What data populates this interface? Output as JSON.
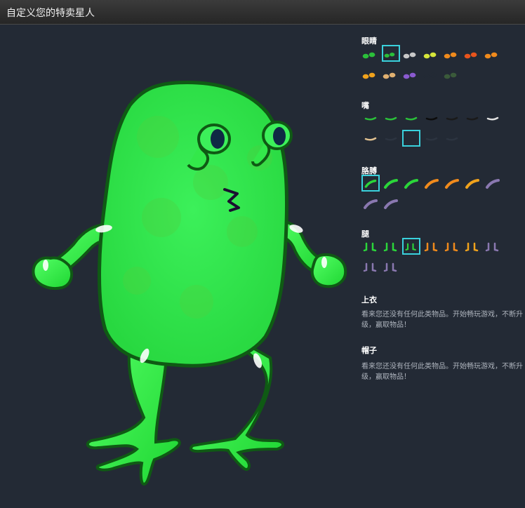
{
  "window": {
    "title": "自定义您的特卖星人"
  },
  "sections": {
    "eyes": {
      "title": "眼睛",
      "selected_index": 1,
      "items": [
        {
          "icon": "eyes-green-small-icon",
          "color": "#2bbf3a"
        },
        {
          "icon": "eyes-green-stalk-icon",
          "color": "#2bbf3a"
        },
        {
          "icon": "eyes-grey-icon",
          "color": "#c8c8c8"
        },
        {
          "icon": "eye-yellow-ring-icon",
          "color": "#d6e63a"
        },
        {
          "icon": "eyes-orange-icon",
          "color": "#f08a1c"
        },
        {
          "icon": "eyes-orange-red-icon",
          "color": "#e8541c"
        },
        {
          "icon": "eyes-orange-wide-icon",
          "color": "#f08a1c"
        },
        {
          "icon": "eyes-orange-yellow-icon",
          "color": "#f0a21c"
        },
        {
          "icon": "eyes-tan-icon",
          "color": "#e0b070"
        },
        {
          "icon": "eye-purple-icon",
          "color": "#8a5ad0"
        },
        {
          "icon": "eyes-none-icon",
          "color": "#232a35"
        },
        {
          "icon": "eyes-dots-icon",
          "color": "#3a5a3a"
        }
      ]
    },
    "mouth": {
      "title": "嘴",
      "selected_index": 9,
      "items": [
        {
          "icon": "mouth-green-icon",
          "color": "#2bbf3a"
        },
        {
          "icon": "mouth-green-2-icon",
          "color": "#2bbf3a"
        },
        {
          "icon": "mouth-green-3-icon",
          "color": "#2bbf3a"
        },
        {
          "icon": "mouth-black-icon",
          "color": "#0c0c0c"
        },
        {
          "icon": "mouth-dark-icon",
          "color": "#1a1a1a"
        },
        {
          "icon": "mouth-dark-2-icon",
          "color": "#1a1a1a"
        },
        {
          "icon": "mouth-teeth-icon",
          "color": "#e0e0e0"
        },
        {
          "icon": "mouth-tan-icon",
          "color": "#e0c090"
        },
        {
          "icon": "mouth-faint-icon",
          "color": "#2c3440"
        },
        {
          "icon": "mouth-empty-icon",
          "color": "#232a35"
        },
        {
          "icon": "mouth-faint-2-icon",
          "color": "#2c3440"
        },
        {
          "icon": "mouth-faint-3-icon",
          "color": "#2c3440"
        }
      ]
    },
    "arms": {
      "title": "胳膊",
      "selected_index": 0,
      "items": [
        {
          "icon": "arm-green-icon",
          "color": "#2bd63a"
        },
        {
          "icon": "arm-green-2-icon",
          "color": "#2bd63a"
        },
        {
          "icon": "arm-green-3-icon",
          "color": "#2bd63a"
        },
        {
          "icon": "arm-orange-icon",
          "color": "#f08a1c"
        },
        {
          "icon": "arm-orange-2-icon",
          "color": "#f08a1c"
        },
        {
          "icon": "arm-orange-3-icon",
          "color": "#f0a21c"
        },
        {
          "icon": "arm-purple-icon",
          "color": "#8a78b0"
        },
        {
          "icon": "arm-purple-2-icon",
          "color": "#8a78b0"
        },
        {
          "icon": "arm-purple-3-icon",
          "color": "#8a78b0"
        }
      ]
    },
    "legs": {
      "title": "腿",
      "selected_index": 2,
      "items": [
        {
          "icon": "legs-green-icon",
          "color": "#2bd63a"
        },
        {
          "icon": "legs-green-2-icon",
          "color": "#2bd63a"
        },
        {
          "icon": "legs-green-3-icon",
          "color": "#2bd63a"
        },
        {
          "icon": "legs-orange-icon",
          "color": "#f08a1c"
        },
        {
          "icon": "legs-orange-2-icon",
          "color": "#f08a1c"
        },
        {
          "icon": "legs-orange-3-icon",
          "color": "#f0a21c"
        },
        {
          "icon": "legs-purple-icon",
          "color": "#8a78b0"
        },
        {
          "icon": "legs-purple-2-icon",
          "color": "#8a78b0"
        },
        {
          "icon": "legs-purple-3-icon",
          "color": "#8a78b0"
        }
      ]
    },
    "shirt": {
      "title": "上衣",
      "empty_message": "看来您还没有任何此类物品。开始畅玩游戏，不断升级，赢取物品！"
    },
    "hat": {
      "title": "帽子",
      "empty_message": "看来您还没有任何此类物品。开始畅玩游戏，不断升级，赢取物品！"
    }
  },
  "character": {
    "body_color": "#33e84a",
    "outline_color": "#0f5a14",
    "eye_color": "#0f2a44"
  }
}
